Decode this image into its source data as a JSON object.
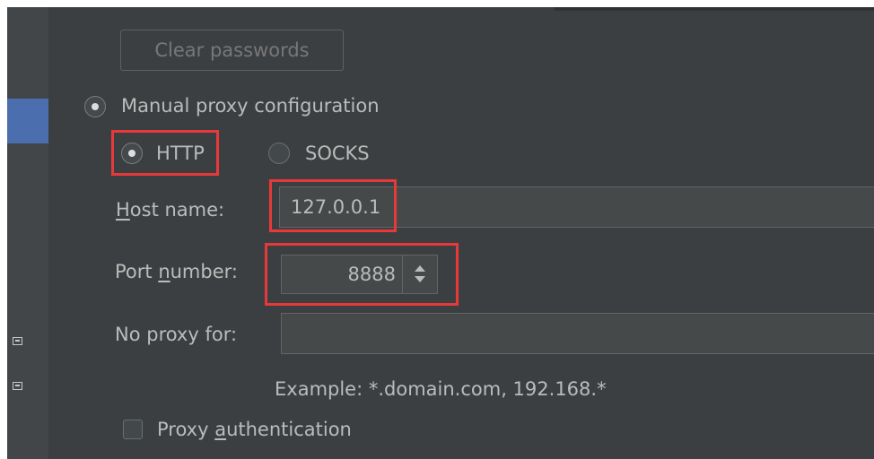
{
  "buttons": {
    "clear_passwords": "Clear passwords"
  },
  "proxy": {
    "manual_label": "Manual proxy configuration",
    "type_http": "HTTP",
    "type_socks": "SOCKS",
    "host_label_mnemonic": "H",
    "host_label_rest": "ost name:",
    "host_value": "127.0.0.1",
    "port_label_start": "Port ",
    "port_label_mnemonic": "n",
    "port_label_rest": "umber:",
    "port_value": "8888",
    "no_proxy_label": "No proxy for:",
    "no_proxy_value": "",
    "example_text": "Example: *.domain.com, 192.168.*",
    "auth_label_start": "Proxy ",
    "auth_label_mnemonic": "a",
    "auth_label_rest": "uthentication"
  },
  "colors": {
    "panel_background": "#3c3f41",
    "text": "#bbbbbb",
    "selection": "#4b6eaf",
    "highlight": "#e8393a"
  },
  "icons": {
    "sidebar_icon_1": "window-icon",
    "sidebar_icon_2": "window-icon",
    "spinner": "up-down-arrows-icon"
  }
}
